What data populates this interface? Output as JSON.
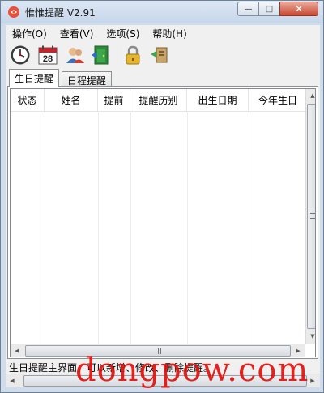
{
  "window": {
    "title": "惟惟提醒 V2.91",
    "minimize_glyph": "—",
    "maximize_glyph": "□",
    "close_glyph": "✕"
  },
  "menu": [
    {
      "label": "操作(O)"
    },
    {
      "label": "查看(V)"
    },
    {
      "label": "选项(S)"
    },
    {
      "label": "帮助(H)"
    }
  ],
  "toolbar": {
    "icons": [
      "clock-icon",
      "calendar-icon",
      "contacts-icon",
      "exit-door-icon",
      "lock-icon",
      "plugin-icon"
    ],
    "calendar_day": "28"
  },
  "tabs": [
    {
      "label": "生日提醒",
      "active": true
    },
    {
      "label": "日程提醒",
      "active": false
    }
  ],
  "list": {
    "columns": [
      "状态",
      "姓名",
      "提前",
      "提醒历别",
      "出生日期",
      "今年生日"
    ],
    "rows": []
  },
  "status": {
    "text": "生日提醒主界面，可以新增、修改、删除提醒。"
  },
  "watermark": "dongpow.com",
  "colors": {
    "close_button": "#c8462f",
    "watermark": "#e0110d",
    "frame": "#cfdcec"
  }
}
